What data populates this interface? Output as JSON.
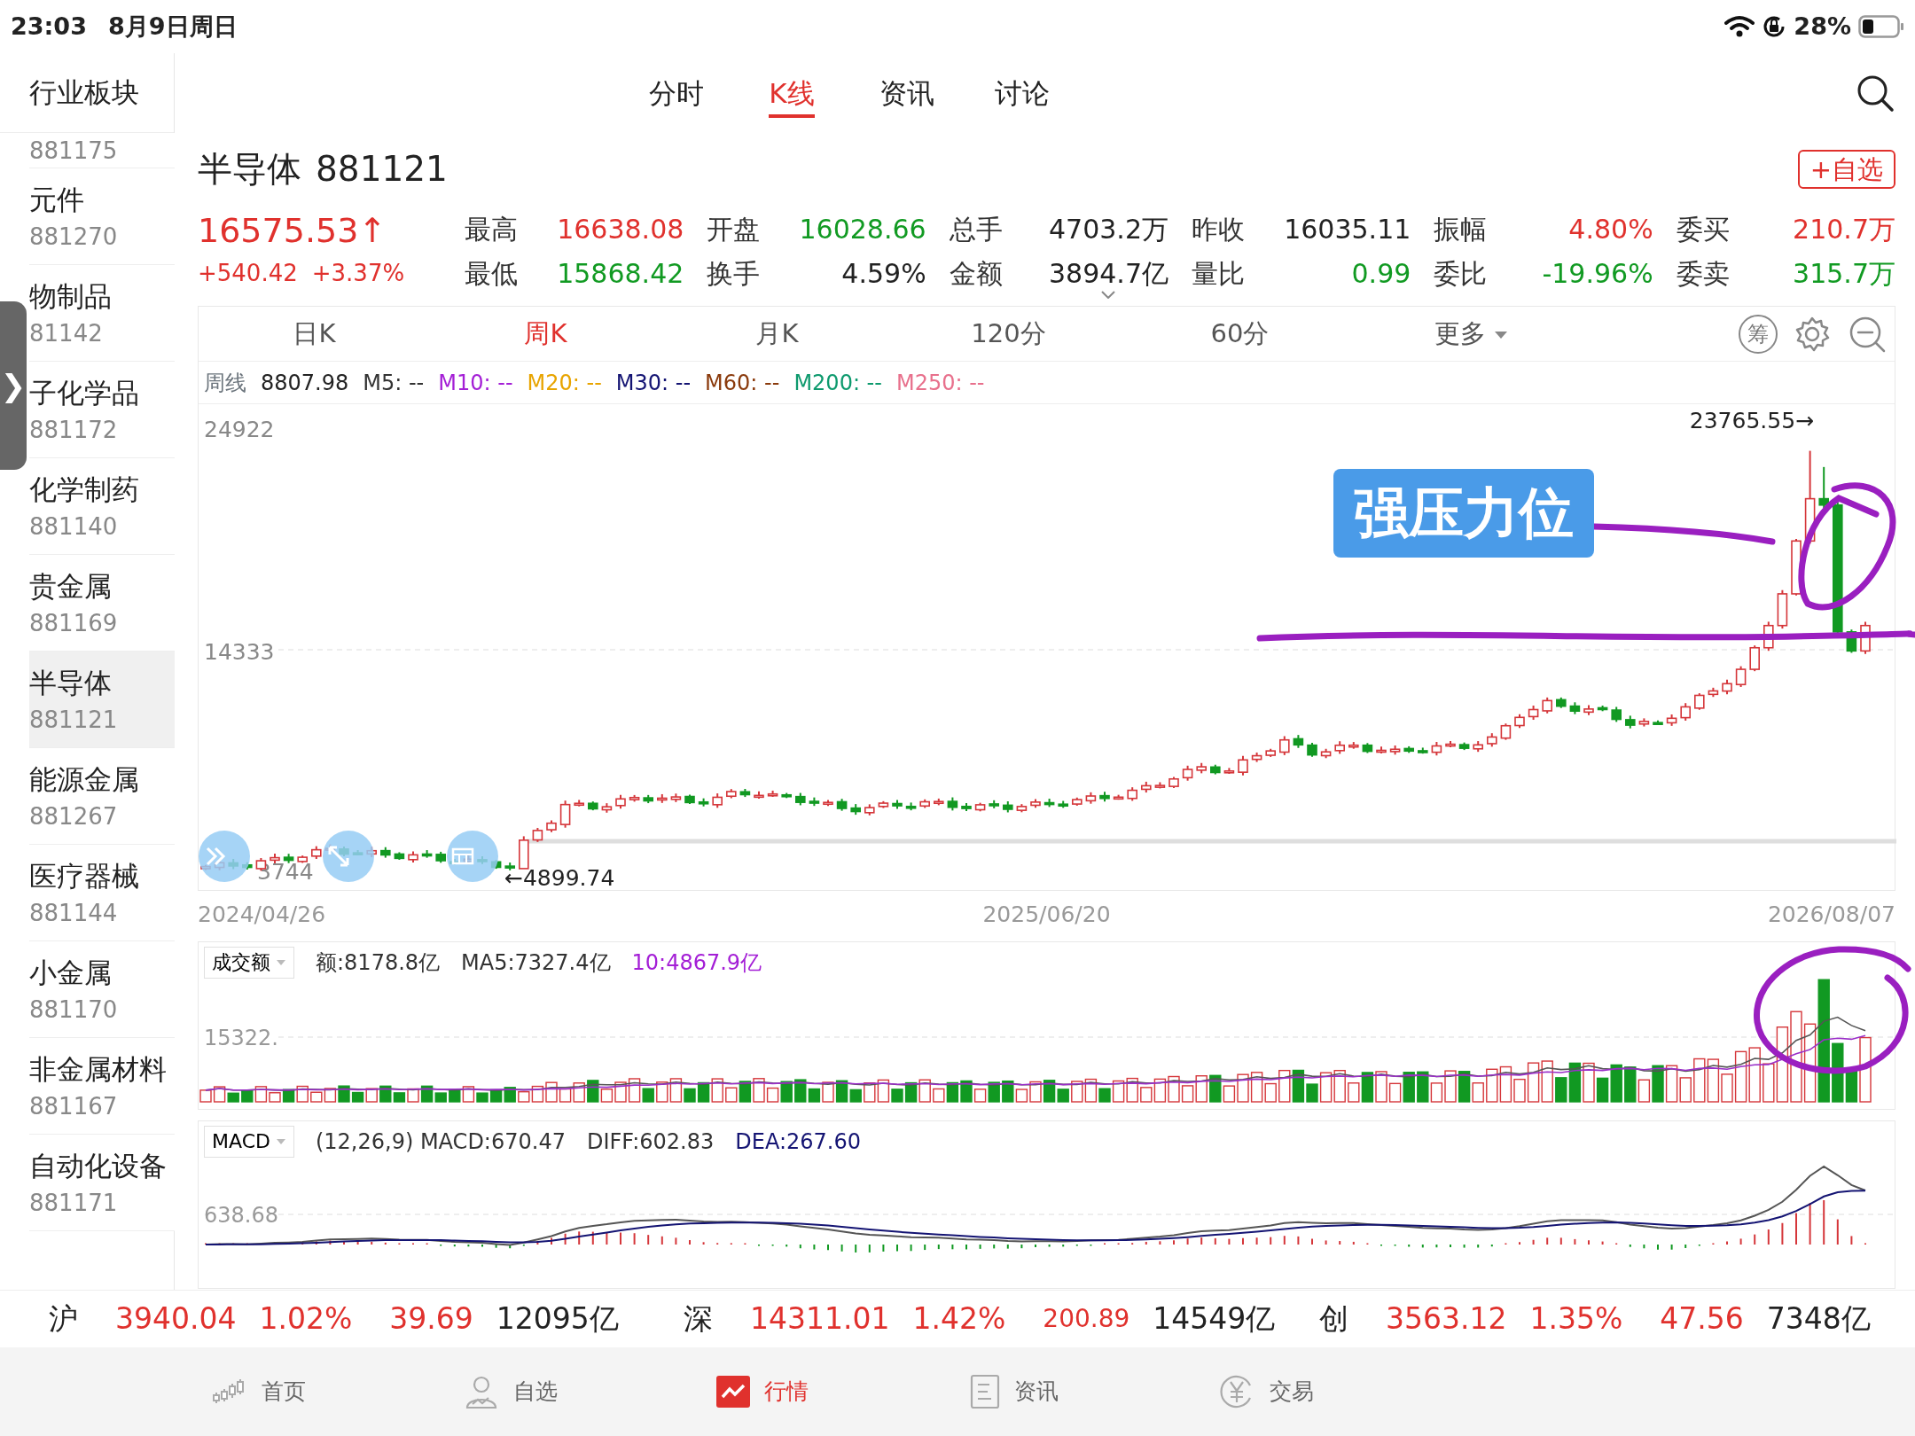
{
  "status_bar": {
    "time": "23:03",
    "date": "8月9日周日",
    "battery": "28%"
  },
  "sidebar": {
    "title": "行业板块",
    "handle": "❯",
    "items": [
      {
        "code": "881175",
        "selected": false
      },
      {
        "name": "元件",
        "code": "881270",
        "selected": false
      },
      {
        "name": "物制品",
        "code": "81142",
        "selected": false
      },
      {
        "name": "子化学品",
        "code": "881172",
        "selected": false
      },
      {
        "name": "化学制药",
        "code": "881140",
        "selected": false
      },
      {
        "name": "贵金属",
        "code": "881169",
        "selected": false
      },
      {
        "name": "半导体",
        "code": "881121",
        "selected": true
      },
      {
        "name": "能源金属",
        "code": "881267",
        "selected": false
      },
      {
        "name": "医疗器械",
        "code": "881144",
        "selected": false
      },
      {
        "name": "小金属",
        "code": "881170",
        "selected": false
      },
      {
        "name": "非金属材料",
        "code": "881167",
        "selected": false
      },
      {
        "name": "自动化设备",
        "code": "881171",
        "selected": false
      }
    ]
  },
  "tabs": [
    {
      "label": "分时",
      "selected": false
    },
    {
      "label": "K线",
      "selected": true
    },
    {
      "label": "资讯",
      "selected": false
    },
    {
      "label": "讨论",
      "selected": false
    }
  ],
  "stock": {
    "name": "半导体",
    "code": "881121",
    "watch_button": "+自选"
  },
  "quote": {
    "price": "16575.53↑",
    "change": "+540.42",
    "percent": "+3.37%",
    "color": "#e0312d"
  },
  "stats": [
    {
      "label": "最高",
      "value": "16638.08",
      "color": "#e0312d",
      "expandable": false
    },
    {
      "label": "开盘",
      "value": "16028.66",
      "color": "#119a22",
      "expandable": false
    },
    {
      "label": "总手",
      "value": "4703.2万",
      "color": "#222222",
      "expandable": false
    },
    {
      "label": "昨收",
      "value": "16035.11",
      "color": "#222222",
      "expandable": false
    },
    {
      "label": "振幅",
      "value": "4.80%",
      "color": "#e0312d",
      "expandable": false
    },
    {
      "label": "委买",
      "value": "210.7万",
      "color": "#e0312d",
      "expandable": false
    },
    {
      "label": "最低",
      "value": "15868.42",
      "color": "#119a22",
      "expandable": false
    },
    {
      "label": "换手",
      "value": "4.59%",
      "color": "#222222",
      "expandable": false
    },
    {
      "label": "金额",
      "value": "3894.7亿",
      "color": "#222222",
      "expandable": true
    },
    {
      "label": "量比",
      "value": "0.99",
      "color": "#119a22",
      "expandable": false
    },
    {
      "label": "委比",
      "value": "-19.96%",
      "color": "#119a22",
      "expandable": false
    },
    {
      "label": "委卖",
      "value": "315.7万",
      "color": "#119a22",
      "expandable": false
    }
  ],
  "periods": [
    {
      "label": "日K",
      "selected": false,
      "kind": "period"
    },
    {
      "label": "周K",
      "selected": true,
      "kind": "period"
    },
    {
      "label": "月K",
      "selected": false,
      "kind": "period"
    },
    {
      "label": "120分",
      "selected": false,
      "kind": "period"
    },
    {
      "label": "60分",
      "selected": false,
      "kind": "period"
    },
    {
      "label": "更多",
      "selected": false,
      "kind": "menu"
    }
  ],
  "chip_button": "筹",
  "ma_legend": {
    "label": "周线",
    "value": "8807.98",
    "items": [
      {
        "label": "M5: --",
        "color": "#333333"
      },
      {
        "label": "M10: --",
        "color": "#a41fd6"
      },
      {
        "label": "M20: --",
        "color": "#e8a400"
      },
      {
        "label": "M30: --",
        "color": "#141473"
      },
      {
        "label": "M60: --",
        "color": "#8a3a0c"
      },
      {
        "label": "M200: --",
        "color": "#0e9a6e"
      },
      {
        "label": "M250: --",
        "color": "#e8708c"
      }
    ]
  },
  "chart": {
    "y_labels": [
      "24922",
      "14333",
      "3744"
    ],
    "high_label": "23765.55→",
    "low_label": "←4899.74",
    "annotation": "强压力位",
    "dates": [
      "2024/04/26",
      "2025/06/20",
      "2026/08/07"
    ]
  },
  "volume": {
    "selector": "成交额",
    "y_label": "15322.",
    "readings": [
      {
        "text": "额:8178.8亿",
        "color": "#333333"
      },
      {
        "text": "MA5:7327.4亿",
        "color": "#333333"
      },
      {
        "text": "10:4867.9亿",
        "color": "#a41fd6"
      }
    ]
  },
  "macd": {
    "selector": "MACD",
    "y_label": "638.68",
    "readings": [
      {
        "text": "(12,26,9) MACD:670.47",
        "color": "#333333"
      },
      {
        "text": "DIFF:602.83",
        "color": "#333333"
      },
      {
        "text": "DEA:267.60",
        "color": "#141473"
      }
    ]
  },
  "index_bar": [
    {
      "market": "沪",
      "price": "3940.04",
      "percent": "1.02%",
      "change": "39.69",
      "amount": "12095亿",
      "color": "#e0312d"
    },
    {
      "market": "深",
      "price": "14311.01",
      "percent": "1.42%",
      "change": "200.89",
      "amount": "14549亿",
      "color": "#e0312d"
    },
    {
      "market": "创",
      "price": "3563.12",
      "percent": "1.35%",
      "change": "47.56",
      "amount": "7348亿",
      "color": "#e0312d"
    }
  ],
  "nav": [
    {
      "label": "首页",
      "kind": "home",
      "selected": false
    },
    {
      "label": "自选",
      "kind": "watchlist",
      "selected": false
    },
    {
      "label": "行情",
      "kind": "market",
      "selected": true
    },
    {
      "label": "资讯",
      "kind": "news",
      "selected": false
    },
    {
      "label": "交易",
      "kind": "trade",
      "selected": false
    }
  ]
}
